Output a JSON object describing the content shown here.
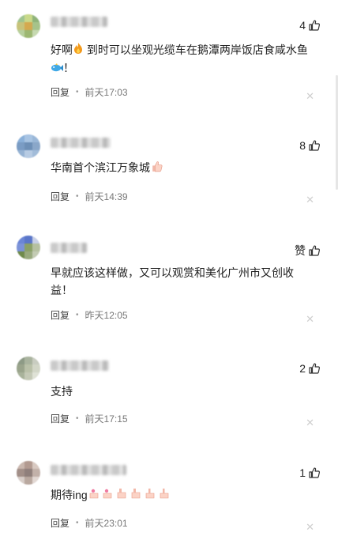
{
  "comments": [
    {
      "text": "好啊",
      "text_after": "到时可以坐观光缆车在鹅潭两岸饭店食咸水鱼",
      "text_tail": "！",
      "likes": "4",
      "reply": "回复",
      "time": "前天17:03"
    },
    {
      "text": "华南首个滨江万象城",
      "likes": "8",
      "reply": "回复",
      "time": "前天14:39"
    },
    {
      "text": "早就应该这样做，又可以观赏和美化广州市又创收益！",
      "likes": "赞",
      "reply": "回复",
      "time": "昨天12:05"
    },
    {
      "text": "支持",
      "likes": "2",
      "reply": "回复",
      "time": "前天17:15"
    },
    {
      "text": "期待ing",
      "likes": "1",
      "reply": "回复",
      "time": "前天23:01"
    }
  ],
  "icons": {
    "like": "thumbs-up-icon",
    "close": "close-icon",
    "fire": "fire-emoji",
    "fish": "fish-emoji",
    "thumbs_emoji": "thumbs-up-emoji"
  },
  "colors": {
    "meta": "#555555",
    "divider_x": "#cfcfcf"
  }
}
